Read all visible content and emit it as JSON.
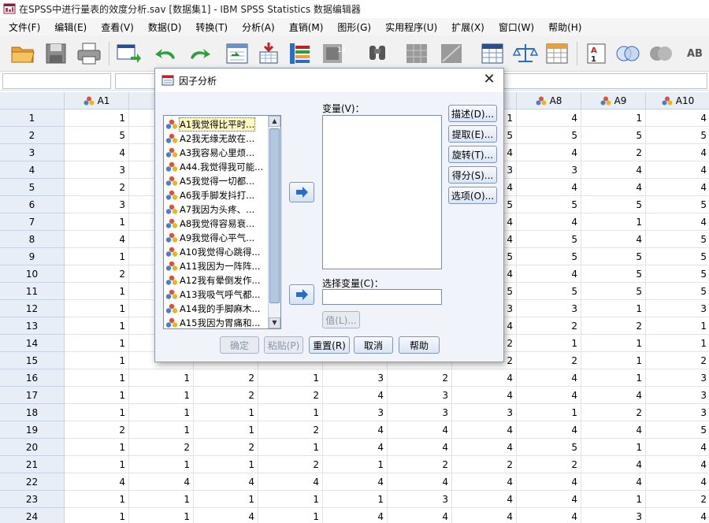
{
  "window": {
    "title": "在SPSS中进行量表的效度分析.sav [数据集1] - IBM SPSS Statistics 数据编辑器"
  },
  "menu": [
    "文件(F)",
    "编辑(E)",
    "查看(V)",
    "数据(D)",
    "转换(T)",
    "分析(A)",
    "直销(M)",
    "图形(G)",
    "实用程序(U)",
    "扩展(X)",
    "窗口(W)",
    "帮助(H)"
  ],
  "toolbar_icons": [
    "open-icon",
    "save-icon",
    "print-icon",
    "recall-dialog-icon",
    "undo-icon",
    "redo-icon",
    "goto-case-icon",
    "goto-variable-icon",
    "variables-icon",
    "run-descriptives-icon",
    "find-icon",
    "insert-cases-icon",
    "insert-variable-icon",
    "split-file-icon",
    "weight-cases-icon",
    "select-cases-icon",
    "value-labels-icon",
    "use-variable-sets-icon",
    "show-all-variables-icon",
    "spell-check-icon"
  ],
  "grid": {
    "columns": [
      "A1",
      "",
      "",
      "",
      "",
      "",
      "",
      "A8",
      "A9",
      "A10"
    ],
    "rows": [
      {
        "n": "1",
        "v": [
          "1",
          "",
          "",
          "",
          "",
          "",
          "1",
          "4",
          "1",
          "4"
        ]
      },
      {
        "n": "2",
        "v": [
          "5",
          "",
          "",
          "",
          "",
          "",
          "5",
          "5",
          "5",
          "5"
        ]
      },
      {
        "n": "3",
        "v": [
          "4",
          "",
          "",
          "",
          "",
          "",
          "4",
          "4",
          "2",
          "4"
        ]
      },
      {
        "n": "4",
        "v": [
          "3",
          "",
          "",
          "",
          "",
          "",
          "3",
          "3",
          "4",
          "4"
        ]
      },
      {
        "n": "5",
        "v": [
          "2",
          "",
          "",
          "",
          "",
          "",
          "4",
          "4",
          "4",
          "4"
        ]
      },
      {
        "n": "6",
        "v": [
          "3",
          "",
          "",
          "",
          "",
          "",
          "5",
          "5",
          "5",
          "5"
        ]
      },
      {
        "n": "7",
        "v": [
          "1",
          "",
          "",
          "",
          "",
          "",
          "4",
          "4",
          "1",
          "4"
        ]
      },
      {
        "n": "8",
        "v": [
          "4",
          "",
          "",
          "",
          "",
          "",
          "4",
          "5",
          "4",
          "5"
        ]
      },
      {
        "n": "9",
        "v": [
          "1",
          "",
          "",
          "",
          "",
          "",
          "5",
          "5",
          "5",
          "5"
        ]
      },
      {
        "n": "10",
        "v": [
          "2",
          "",
          "",
          "",
          "",
          "",
          "4",
          "4",
          "5",
          "5"
        ]
      },
      {
        "n": "11",
        "v": [
          "1",
          "",
          "",
          "",
          "",
          "",
          "5",
          "5",
          "5",
          "5"
        ]
      },
      {
        "n": "12",
        "v": [
          "1",
          "",
          "",
          "",
          "",
          "",
          "3",
          "3",
          "1",
          "3"
        ]
      },
      {
        "n": "13",
        "v": [
          "1",
          "",
          "",
          "",
          "",
          "",
          "4",
          "2",
          "2",
          "1"
        ]
      },
      {
        "n": "14",
        "v": [
          "1",
          "",
          "",
          "",
          "",
          "",
          "2",
          "1",
          "1",
          "1"
        ]
      },
      {
        "n": "15",
        "v": [
          "1",
          "",
          "",
          "",
          "",
          "",
          "2",
          "2",
          "1",
          "2"
        ]
      },
      {
        "n": "16",
        "v": [
          "1",
          "1",
          "2",
          "1",
          "3",
          "2",
          "4",
          "4",
          "1",
          "3"
        ]
      },
      {
        "n": "17",
        "v": [
          "1",
          "1",
          "2",
          "2",
          "4",
          "3",
          "4",
          "4",
          "4",
          "3"
        ]
      },
      {
        "n": "18",
        "v": [
          "1",
          "1",
          "1",
          "1",
          "3",
          "3",
          "3",
          "1",
          "2",
          "3"
        ]
      },
      {
        "n": "19",
        "v": [
          "2",
          "1",
          "1",
          "2",
          "4",
          "4",
          "4",
          "4",
          "4",
          "5"
        ]
      },
      {
        "n": "20",
        "v": [
          "1",
          "2",
          "2",
          "1",
          "4",
          "4",
          "4",
          "5",
          "1",
          "4"
        ]
      },
      {
        "n": "21",
        "v": [
          "1",
          "1",
          "1",
          "2",
          "1",
          "2",
          "2",
          "2",
          "4",
          "4"
        ]
      },
      {
        "n": "22",
        "v": [
          "4",
          "4",
          "4",
          "4",
          "4",
          "4",
          "4",
          "4",
          "4",
          "4"
        ]
      },
      {
        "n": "23",
        "v": [
          "1",
          "1",
          "1",
          "1",
          "1",
          "3",
          "4",
          "4",
          "1",
          "2"
        ]
      },
      {
        "n": "24",
        "v": [
          "1",
          "1",
          "4",
          "1",
          "4",
          "4",
          "4",
          "4",
          "3",
          "4"
        ]
      }
    ]
  },
  "dialog": {
    "title": "因子分析",
    "variables": [
      "A1我觉得比平时...",
      "A2我无缘无故在...",
      "A3我容易心里烦...",
      "A44.我觉得我可能...",
      "A5我觉得一切都...",
      "A6我手脚发抖打...",
      "A7我因为头疼、...",
      "A8我觉得容易衰...",
      "A9我觉得心平气...",
      "A10我觉得心跳得...",
      "A11我因为一阵阵...",
      "A12我有晕倒发作...",
      "A13我吸气呼气都...",
      "A14我的手脚麻木...",
      "A15我因为胃痛和..."
    ],
    "variables_label": "变量(V)：",
    "selection_label": "选择变量(C)：",
    "value_button": "值(L)...",
    "side_buttons": [
      "描述(D)...",
      "提取(E)...",
      "旋转(T)...",
      "得分(S)...",
      "选项(O)..."
    ],
    "ok": "确定",
    "paste": "粘贴(P)",
    "reset": "重置(R)",
    "cancel": "取消",
    "help": "帮助",
    "close": "✕"
  }
}
